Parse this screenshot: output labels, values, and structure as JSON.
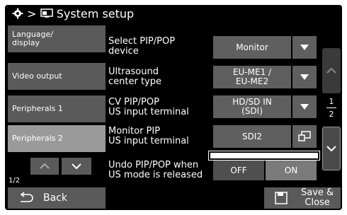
{
  "header": {
    "breadcrumb_sep": ">",
    "title": "System setup"
  },
  "sidebar": {
    "items": [
      {
        "label": "Language/\ndisplay"
      },
      {
        "label": "Video output"
      },
      {
        "label": "Peripherals 1"
      },
      {
        "label": "Peripherals 2"
      }
    ],
    "page": "1/2"
  },
  "rows": [
    {
      "label": "Select PIP/POP\ndevice",
      "value": "Monitor"
    },
    {
      "label": "Ultrasound\ncenter type",
      "value": "EU-ME1 /\nEU-ME2"
    },
    {
      "label": "CV PIP/POP\nUS input terminal",
      "value": "HD/SD IN\n(SDI)"
    },
    {
      "label": "Monitor PIP\nUS input terminal",
      "value": "SDI2"
    },
    {
      "label": "Undo PIP/POP when\nUS mode is released",
      "off_label": "OFF",
      "on_label": "ON"
    }
  ],
  "scroll": {
    "current_page": "1",
    "total_pages": "2"
  },
  "footer": {
    "back_label": "Back",
    "save_label": "Save &\nClose"
  }
}
